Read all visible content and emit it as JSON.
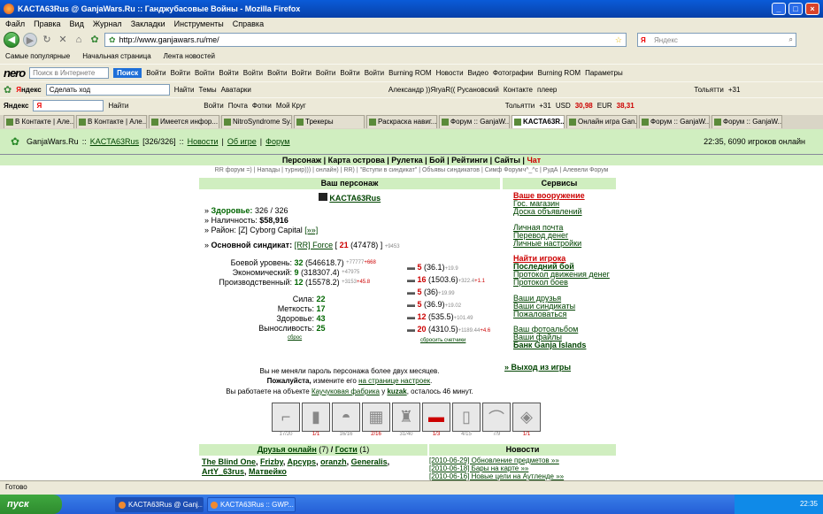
{
  "window": {
    "title": "KACTA63Rus @ GanjaWars.Ru :: Ганджубасовые Войны - Mozilla Firefox"
  },
  "menu": [
    "Файл",
    "Правка",
    "Вид",
    "Журнал",
    "Закладки",
    "Инструменты",
    "Справка"
  ],
  "nav": {
    "url": "http://www.ganjawars.ru/me/",
    "search_placeholder": "Яндекс"
  },
  "bookmarks": [
    "Самые популярные",
    "Начальная страница",
    "Лента новостей"
  ],
  "nero_bar": {
    "search_placeholder": "Поиск в Интернете",
    "search_btn": "Поиск",
    "items": [
      "Войти",
      "Войти",
      "Войти",
      "Войти",
      "Войти",
      "Войти",
      "Войти",
      "Войти",
      "Войти",
      "Войти",
      "Burning ROM",
      "Новости",
      "Видео",
      "Фотографии",
      "Burning ROM",
      "Параметры"
    ]
  },
  "yandex_bar1": {
    "input": "Сделать ход",
    "items": [
      "Найти",
      "Темы",
      "Аватарки",
      "Александр ))ЯryaR(( Русановский",
      "Контакте",
      "плеер",
      "Тольятти",
      "+31"
    ]
  },
  "yandex_bar2": {
    "items": [
      "Найти",
      "Войти",
      "Почта",
      "Фотки",
      "Мой Круг",
      "Тольятти",
      "+31",
      "USD",
      "30,98",
      "EUR",
      "38,31"
    ]
  },
  "tabs": [
    "В Контакте | Але...",
    "В Контакте | Але...",
    "Имеется инфор...",
    "NitroSyndrome Sy...",
    "Трекеры",
    "Раскраска навиг...",
    "Форум :: GanjaW...",
    "KACTA63R...",
    "Онлайн игра Gan...",
    "Форум :: GanjaW...",
    "Форум :: GanjaW..."
  ],
  "site": {
    "name": "GanjaWars.Ru",
    "user": "KACTA63Rus",
    "counts": "[326/326]",
    "links": [
      "Новости",
      "Об игре",
      "Форум"
    ],
    "online": "22:35, 6090 игроков онлайн",
    "menu": [
      "Персонаж",
      "Карта острова",
      "Рулетка",
      "Бой",
      "Рейтинги",
      "Сайты",
      "Чат"
    ],
    "submenu": "RR форум =) | Напады | турнир))) | онлайн) | RR) | \"Вступи в синдикат\" | Объявы синдикатов | Симф Форумч^_^с | РудА | Алевели Форум"
  },
  "char": {
    "header": "Ваш персонаж",
    "name": "KACTA63Rus",
    "health_label": "Здоровье:",
    "health": "326 / 326",
    "cash_label": "Наличность:",
    "cash": "$58,916",
    "district_label": "Район:",
    "district": "[Z] Cyborg Capital",
    "district_link": "[»»]",
    "synd_label": "Основной синдикат:",
    "synd": "[RR] Force",
    "synd_lvl": "21",
    "synd_exp": "(47478)",
    "synd_plus": "+9453",
    "levels": [
      {
        "label": "Боевой уровень:",
        "val": "32",
        "exp": "(546618.7)",
        "a": "+77777",
        "b": "+668"
      },
      {
        "label": "Экономический:",
        "val": "9",
        "exp": "(318307.4)",
        "a": "+47975",
        "b": ""
      },
      {
        "label": "Производственный:",
        "val": "12",
        "exp": "(15578.2)",
        "a": "+3153",
        "b": "+45.8"
      }
    ],
    "attrs": [
      {
        "label": "Сила:",
        "val": "22"
      },
      {
        "label": "Меткость:",
        "val": "17"
      },
      {
        "label": "Здоровье:",
        "val": "43"
      },
      {
        "label": "Выносливость:",
        "val": "25"
      }
    ],
    "attrs_link": "сброс",
    "skills": [
      {
        "val": "5",
        "exp": "(36.1)",
        "add": "+19.9",
        "bonus": ""
      },
      {
        "val": "16",
        "exp": "(1503.6)",
        "add": "+322.4",
        "bonus": "+1.1"
      },
      {
        "val": "5",
        "exp": "(36)",
        "add": "+19.99",
        "bonus": ""
      },
      {
        "val": "5",
        "exp": "(36.9)",
        "add": "+19.02",
        "bonus": ""
      },
      {
        "val": "12",
        "exp": "(535.5)",
        "add": "+101.49",
        "bonus": ""
      },
      {
        "val": "20",
        "exp": "(4310.5)",
        "add": "+1189.44",
        "bonus": "+4.6"
      }
    ],
    "skills_link": "сбросить счетчики",
    "pwd_msg1": "Вы не меняли пароль персонажа более двух месяцев.",
    "pwd_msg2a": "Пожалуйста,",
    "pwd_msg2b": "измените его",
    "pwd_link": "на странице настроек",
    "work_msg": "Вы работаете на объекте",
    "work_obj": "Каучуковая фабрика",
    "work_by": "у",
    "work_owner": "kuzak",
    "work_rest": ", осталось 46 минут."
  },
  "equip": [
    {
      "icon": "⌐",
      "count": "17/20"
    },
    {
      "icon": "▮",
      "count": "1/1"
    },
    {
      "icon": "◓",
      "count": "16/16"
    },
    {
      "icon": "▦",
      "count": "2/16"
    },
    {
      "icon": "♜",
      "count": "31/40"
    },
    {
      "icon": "▬",
      "count": "1/3"
    },
    {
      "icon": "▯",
      "count": "4/15"
    },
    {
      "icon": "⌒",
      "count": "7/9"
    },
    {
      "icon": "◈",
      "count": "1/1"
    }
  ],
  "services": {
    "header": "Сервисы",
    "groups": [
      [
        "Ваше вооружение",
        "Гос. магазин",
        "Доска объявлений"
      ],
      [
        "Личная почта",
        "Перевод денег",
        "Личные настройки"
      ],
      [
        "Найти игрока",
        "Последний бой",
        "Протокол движения денег",
        "Протокол боев"
      ],
      [
        "Ваши друзья",
        "Ваши синдикаты",
        "Пожаловаться"
      ],
      [
        "Ваш фотоальбом",
        "Ваши файлы",
        "Банк Ganja Islands"
      ]
    ],
    "exit": "Выход из игры"
  },
  "friends": {
    "header_a": "Друзья онлайн",
    "count_a": "(7)",
    "header_b": "Гости",
    "count_b": "(1)",
    "names": [
      "The Blind One",
      "Frizby",
      "Apcyps",
      "oranzh",
      "Generalis",
      "ArtY_63rus",
      "Матвейко"
    ]
  },
  "news": {
    "header": "Новости",
    "items": [
      "[2010-06-29] Обновление предметов »»",
      "[2010-06-18] Бары на карте »»",
      "[2010-06-16] Новые цели на Аутленде »»"
    ]
  },
  "status": "Готово",
  "taskbar": {
    "start": "пуск",
    "tasks": [
      "KACTA63Rus @ Ganj...",
      "KACTA63Rus :: GWP..."
    ],
    "time": "22:35"
  }
}
